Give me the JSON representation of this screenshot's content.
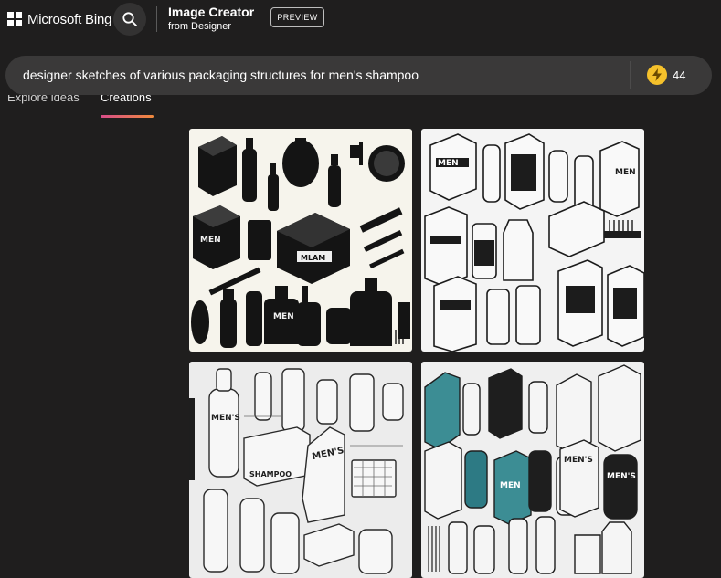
{
  "header": {
    "brand": "Microsoft Bing",
    "search_icon": "search-icon",
    "app_title": "Image Creator",
    "app_subtitle": "from Designer",
    "preview_badge": "PREVIEW"
  },
  "prompt": {
    "value": "designer sketches of various packaging structures for men's shampoo",
    "boost_icon": "lightning-bolt-icon",
    "boost_count": "44"
  },
  "tabs": [
    {
      "label": "Explore ideas",
      "active": false
    },
    {
      "label": "Creations",
      "active": true
    }
  ],
  "colors": {
    "background": "#1f1e1e",
    "prompt_bar": "#3a3939",
    "boost": "#f5c12b",
    "tab_gradient_start": "#d84c8a",
    "tab_gradient_end": "#f08a3c"
  },
  "images": [
    {
      "labels": [
        "MEN",
        "MEN",
        "MLAM"
      ]
    },
    {
      "labels": [
        "MEN",
        "MEN"
      ]
    },
    {
      "labels": [
        "MEN'S",
        "MEN'S",
        "SHAMPOO"
      ]
    },
    {
      "labels": [
        "MEN",
        "MEN'S",
        "MEN'S"
      ]
    }
  ]
}
